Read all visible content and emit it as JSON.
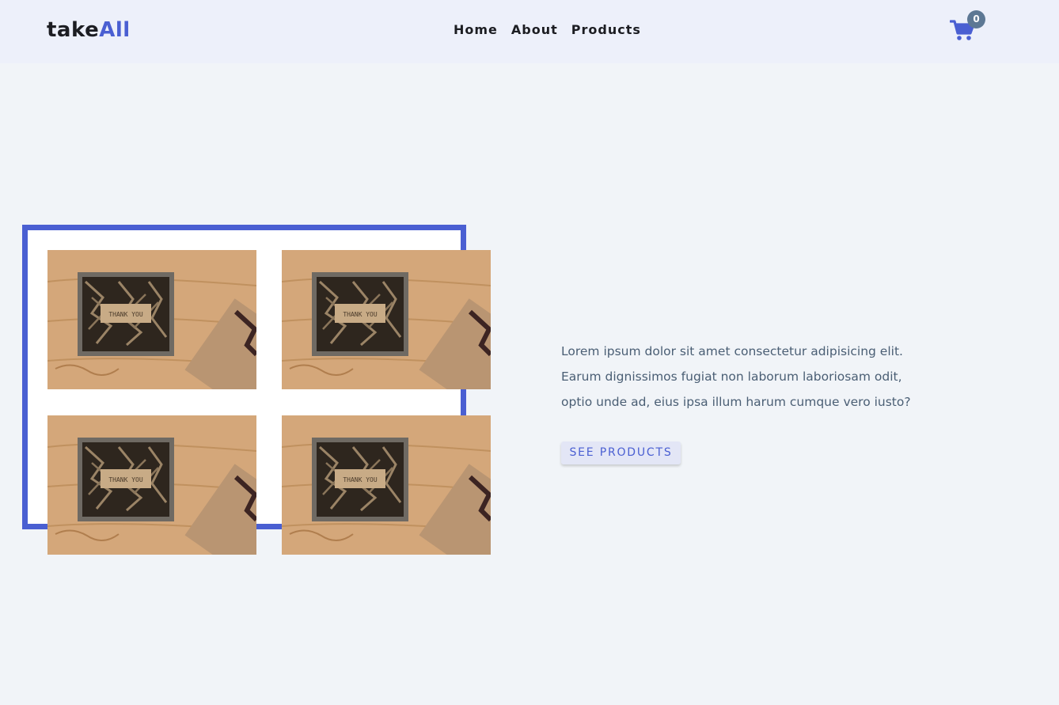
{
  "header": {
    "logo_part1": "take",
    "logo_part2": "All",
    "nav": [
      {
        "label": "Home"
      },
      {
        "label": "About"
      },
      {
        "label": "Products"
      }
    ],
    "cart_count": "0"
  },
  "hero": {
    "description": "Lorem ipsum dolor sit amet consectetur adipisicing elit. Earum dignissimos fugiat non laborum laboriosam odit, optio unde ad, eius ipsa illum harum cumque vero iusto?",
    "button_label": "SEE PRODUCTS",
    "product_image_text": "THANK YOU"
  },
  "colors": {
    "accent": "#4a5fd2",
    "header_bg": "#edf0fa",
    "page_bg": "#f1f4f8",
    "badge": "#5d7894",
    "text": "#4a5e74"
  },
  "icons": {
    "cart": "shopping-cart-icon"
  }
}
